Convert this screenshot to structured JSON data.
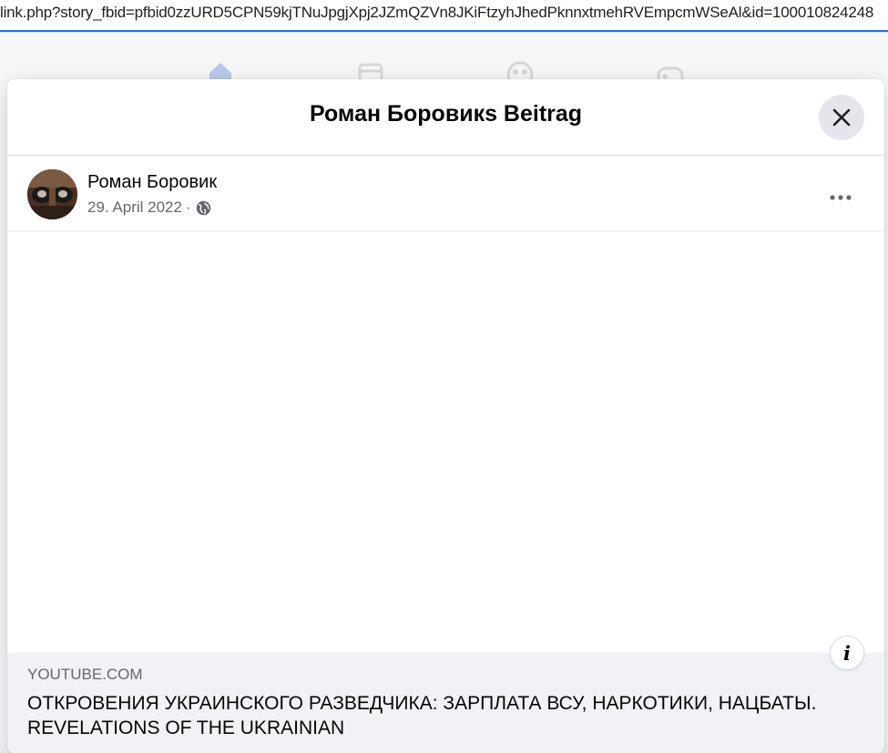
{
  "browser": {
    "url": "link.php?story_fbid=pfbid0zzURD5CPN59kjTNuJpgjXpj2JZmQZVn8JKiFtzyhJhedPknnxtmehRVEmpcmWSeAl&id=100010824248"
  },
  "background_nav": {
    "icons": [
      "home-icon",
      "marketplace-icon",
      "groups-icon",
      "gaming-icon"
    ]
  },
  "modal": {
    "title": "Роман Боровикs Beitrag",
    "close_icon": "close-icon"
  },
  "post": {
    "author": "Роман Боровик",
    "date": "29. April 2022",
    "separator": "·",
    "privacy_icon": "globe-icon",
    "more_icon": "more-options-icon"
  },
  "link_preview": {
    "domain": "YOUTUBE.COM",
    "title": "ОТКРОВЕНИЯ УКРАИНСКОГО РАЗВЕДЧИКА: ЗАРПЛАТА ВСУ, НАРКОТИКИ, НАЦБАТЫ. REVELATIONS OF THE UKRAINIAN",
    "info_icon": "info-icon",
    "info_glyph": "i"
  },
  "colors": {
    "accent": "#1a73e8",
    "modal_bg": "#ffffff",
    "secondary_text": "#65676b",
    "preview_bg": "#f0f2f5"
  }
}
